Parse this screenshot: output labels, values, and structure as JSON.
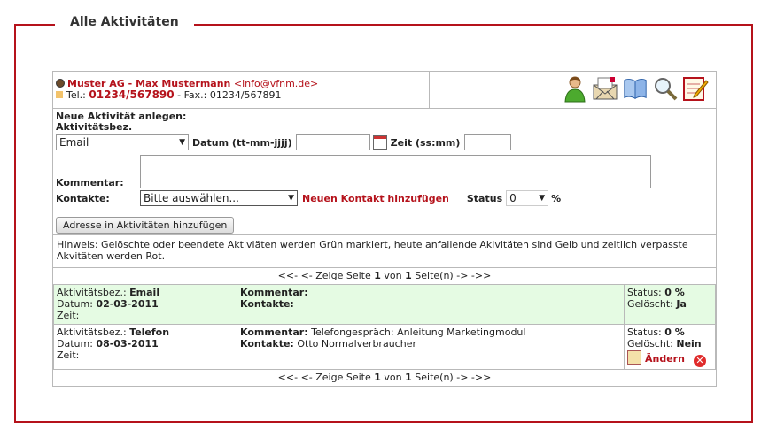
{
  "section_title": "Alle Aktivitäten",
  "contact": {
    "company": "Muster AG - Max Mustermann",
    "email": "<info@vfnm.de>",
    "tel_label": "Tel.:",
    "tel": "01234/567890",
    "fax": "- Fax.: 01234/567891"
  },
  "toolbar_icons": [
    "user-icon",
    "mail-icon",
    "book-icon",
    "search-icon",
    "edit-icon"
  ],
  "form": {
    "heading": "Neue Aktivität anlegen:",
    "type_label": "Aktivitätsbez.",
    "type_value": "Email",
    "date_label": "Datum (tt-mm-jjjj)",
    "date_value": "",
    "time_label": "Zeit (ss:mm)",
    "time_value": "",
    "comment_label": "Kommentar:",
    "comment_value": "",
    "contacts_label": "Kontakte:",
    "contacts_value": "Bitte auswählen...",
    "add_contact_link": "Neuen Kontakt hinzufügen",
    "status_label": "Status",
    "status_value": "0",
    "status_unit": "%",
    "add_address_button": "Adresse in Aktivitäten hinzufügen"
  },
  "hint": "Hinweis: Gelöschte oder beendete Aktiviäten werden Grün markiert, heute anfallende Akivitäten sind Gelb und zeitlich verpasste Akvitäten werden Rot.",
  "pager": {
    "prefix": "<<- <- Zeige Seite",
    "page": "1",
    "of": "von",
    "total": "1",
    "suffix": "Seite(n) -> ->>"
  },
  "activities": [
    {
      "type_label": "Aktivitätsbez.:",
      "type": "Email",
      "date_label": "Datum:",
      "date": "02-03-2011",
      "time_label": "Zeit:",
      "comment_label": "Kommentar:",
      "comment": "",
      "contacts_label": "Kontakte:",
      "contacts": "",
      "status_label": "Status:",
      "status": "0 %",
      "deleted_label": "Gelöscht:",
      "deleted": "Ja"
    },
    {
      "type_label": "Aktivitätsbez.:",
      "type": "Telefon",
      "date_label": "Datum:",
      "date": "08-03-2011",
      "time_label": "Zeit:",
      "comment_label": "Kommentar:",
      "comment": "Telefongespräch: Anleitung Marketingmodul",
      "contacts_label": "Kontakte:",
      "contacts": "Otto Normalverbraucher",
      "status_label": "Status:",
      "status": "0 %",
      "deleted_label": "Gelöscht:",
      "deleted": "Nein",
      "edit_label": "Ändern"
    }
  ]
}
